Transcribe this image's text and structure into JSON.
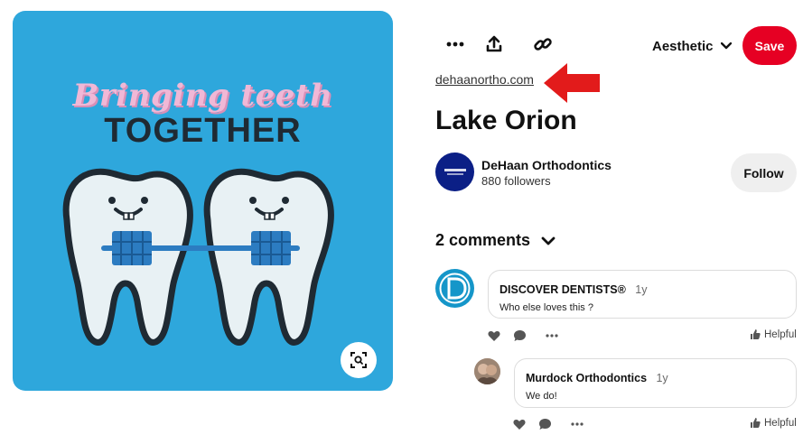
{
  "pin_image": {
    "headline_line1": "Bringing teeth",
    "headline_line2": "TOGETHER",
    "colors": {
      "background": "#2ea7dc",
      "pink": "#f0b8d6",
      "dark": "#1f2a33",
      "braces": "#2c7cc1"
    },
    "lens_icon": "visual-search-icon"
  },
  "toolbar": {
    "more_icon": "more-dots-icon",
    "share_icon": "share-upload-icon",
    "link_icon": "link-icon",
    "board_label": "Aesthetic",
    "board_chevron": "chevron-down-icon",
    "save_label": "Save",
    "save_color": "#e60023"
  },
  "source": {
    "link_text": "dehaanortho.com",
    "arrow_color": "#e21b1b"
  },
  "pin": {
    "title": "Lake Orion"
  },
  "creator": {
    "name": "DeHaan Orthodontics",
    "followers": "880 followers",
    "follow_label": "Follow",
    "avatar_color": "#0b1f86"
  },
  "comments": {
    "header": "2 comments",
    "items": [
      {
        "author": "DISCOVER DENTISTS®",
        "time": "1y",
        "text": "Who else loves this ?",
        "helpful_label": "Helpful"
      },
      {
        "author": "Murdock Orthodontics",
        "time": "1y",
        "text": "We do!",
        "helpful_label": "Helpful"
      }
    ]
  }
}
